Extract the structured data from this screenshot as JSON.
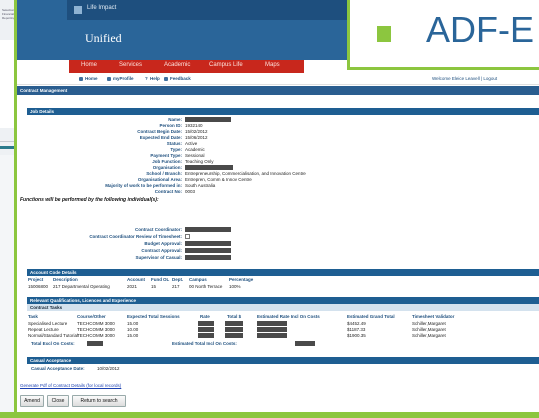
{
  "slide": {
    "title": "ADF-E"
  },
  "left_strip": {
    "text": "Selection... Financial Reporting"
  },
  "portal": {
    "top_link": "Life Impact",
    "brand": "Unified",
    "nav": [
      "Home",
      "Services",
      "Academic",
      "Campus Life",
      "Maps"
    ],
    "subnav": [
      "Home",
      "myProfile",
      "Help",
      "Feedback"
    ],
    "welcome": "Welcome Eleice Leavell | Logout"
  },
  "page": {
    "section_title": "Contract Management"
  },
  "job_details": {
    "header": "Job Details",
    "fields": [
      {
        "label": "Name:",
        "value": ""
      },
      {
        "label": "Person ID:",
        "value": "1932140"
      },
      {
        "label": "Contract Begin Date:",
        "value": "15/02/2012"
      },
      {
        "label": "Expected End Date:",
        "value": "15/06/2012"
      },
      {
        "label": "Status:",
        "value": "Active"
      },
      {
        "label": "Type:",
        "value": "Academic"
      },
      {
        "label": "Payment Type:",
        "value": "Sessional"
      },
      {
        "label": "Job Function:",
        "value": "Teaching Only"
      },
      {
        "label": "Organisation:",
        "value": ""
      },
      {
        "label": "School / Branch:",
        "value": "Entrepreneurship, Commercialisation, and Innovation Centre"
      },
      {
        "label": "Organisational Area:",
        "value": "Entrepren, Comm & Innov Centre"
      },
      {
        "label": "Majority of work to be performed in:",
        "value": "South Australia"
      },
      {
        "label": "Contract No:",
        "value": "0003"
      }
    ],
    "functions_note": "Functions will be performed by the following individual(s):",
    "approvals": [
      {
        "label": "Contract Coordinator:"
      },
      {
        "label": "Contract Coordinator Review of Timesheet:"
      },
      {
        "label": "Budget Approval:"
      },
      {
        "label": "Contract Approval:"
      },
      {
        "label": "Supervisor of Casual:"
      }
    ]
  },
  "account": {
    "header": "Account Code Details",
    "columns": [
      "Project",
      "Description",
      "Account",
      "Fund",
      "OL",
      "Dept.",
      "Campus",
      "Percentage"
    ],
    "row": [
      "15006800",
      "217 Departmental Operating",
      "2021",
      "15",
      "",
      "217",
      "00 North Terrace",
      "100%"
    ]
  },
  "quals": {
    "header": "Relevant Qualifications, Licences and Experience",
    "subheader": "Contract Tasks",
    "columns": [
      "Task",
      "Course/Other",
      "Expected Total Sessions",
      "Rate",
      "Total $",
      "Estimated Rate Incl On Costs",
      "Estimated Grand Total",
      "Timesheet Validator"
    ],
    "rows": [
      [
        "Specialised Lecture",
        "TECHCOMM 3000",
        "15.00",
        "",
        "",
        "",
        "$4452.49",
        "Schiller,Margaret"
      ],
      [
        "Repeat Lecture",
        "TECHCOMM 3000",
        "10.00",
        "",
        "",
        "",
        "$1187.33",
        "Schiller,Margaret"
      ],
      [
        "Normal/Standard Tutorial",
        "TECHCOMM 3000",
        "15.00",
        "",
        "",
        "",
        "$1900.35",
        "Schiller,Margaret"
      ]
    ],
    "total_excl": "Total Excl On Costs:",
    "total_incl": "Estimated Total Incl On Costs:"
  },
  "casual": {
    "header": "Casual Acceptance",
    "date_label": "Casual Acceptance Date:",
    "date_value": "10/02/2012"
  },
  "pdf_link": "Generate Pdf of Contract Details (for local records)",
  "buttons": {
    "amend": "Amend",
    "close": "Close",
    "return": "Return to search"
  },
  "colors": {
    "accent_green": "#8cc63f",
    "header_blue": "#2a6599",
    "nav_red": "#c8271c"
  }
}
